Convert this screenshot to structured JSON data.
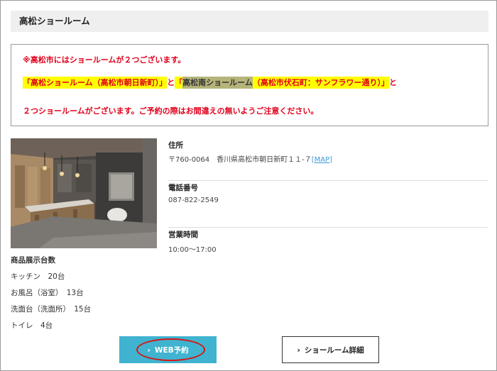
{
  "header": {
    "title": "高松ショールーム"
  },
  "notice": {
    "line1": "※高松市にはショールームが２つございます。",
    "line2_part1": "「高松ショールーム（高松市朝日新町）」",
    "line2_part2": "と",
    "line2_part3": "「",
    "line2_part4": "高松南ショールーム",
    "line2_part5": "（高松市伏石町：サンフラワー通り）」",
    "line2_part6": "と",
    "line3": "２つショールームがございます。ご予約の際はお間違えの無いようご注意ください。"
  },
  "exhibit": {
    "title": "商品展示台数",
    "items": [
      "キッチン　20台",
      "お風呂（浴室）　13台",
      "洗面台（洗面所）　15台",
      "トイレ　4台"
    ]
  },
  "info": {
    "address_label": "住所",
    "address_value": "〒760-0064　香川県高松市朝日新町１１-７",
    "map_open": "[",
    "map_link": "MAP",
    "map_close": "]",
    "phone_label": "電話番号",
    "phone_value": "087-822-2549",
    "hours_label": "営業時間",
    "hours_value": "10:00～17:00"
  },
  "buttons": {
    "web_reserve": "WEB予約",
    "showroom_detail": "ショールーム詳細"
  },
  "colors": {
    "accent_button": "#3fb3cf",
    "notice_red": "#e0001b",
    "highlight_yellow": "#ffff00",
    "highlight_olive": "#b5b57a",
    "annotation_oval": "#d41717"
  }
}
